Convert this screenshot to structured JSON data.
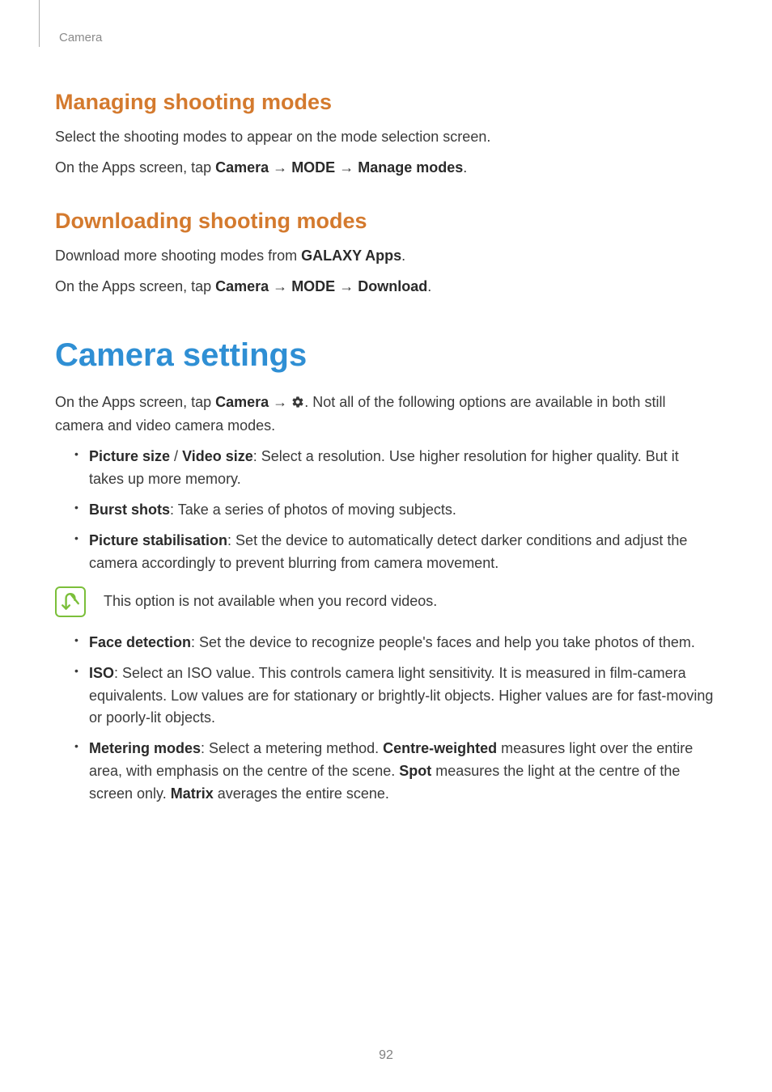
{
  "breadcrumb": "Camera",
  "section1": {
    "heading": "Managing shooting modes",
    "p1": "Select the shooting modes to appear on the mode selection screen.",
    "p2_prefix": "On the Apps screen, tap ",
    "p2_b1": "Camera",
    "p2_arrow1": " → ",
    "p2_b2": "MODE",
    "p2_arrow2": " → ",
    "p2_b3": "Manage modes",
    "p2_suffix": "."
  },
  "section2": {
    "heading": "Downloading shooting modes",
    "p1_prefix": "Download more shooting modes from ",
    "p1_b1": "GALAXY Apps",
    "p1_suffix": ".",
    "p2_prefix": "On the Apps screen, tap ",
    "p2_b1": "Camera",
    "p2_arrow1": " → ",
    "p2_b2": "MODE",
    "p2_arrow2": " → ",
    "p2_b3": "Download",
    "p2_suffix": "."
  },
  "section3": {
    "heading": "Camera settings",
    "intro_prefix": "On the Apps screen, tap ",
    "intro_b1": "Camera",
    "intro_arrow": " → ",
    "intro_suffix": ". Not all of the following options are available in both still camera and video camera modes.",
    "bullets1": {
      "b1_bold1": "Picture size",
      "b1_sep": " / ",
      "b1_bold2": "Video size",
      "b1_rest": ": Select a resolution. Use higher resolution for higher quality. But it takes up more memory.",
      "b2_bold": "Burst shots",
      "b2_rest": ": Take a series of photos of moving subjects.",
      "b3_bold": "Picture stabilisation",
      "b3_rest": ": Set the device to automatically detect darker conditions and adjust the camera accordingly to prevent blurring from camera movement."
    },
    "note": "This option is not available when you record videos.",
    "bullets2": {
      "b4_bold": "Face detection",
      "b4_rest": ": Set the device to recognize people's faces and help you take photos of them.",
      "b5_bold": "ISO",
      "b5_rest": ": Select an ISO value. This controls camera light sensitivity. It is measured in film-camera equivalents. Low values are for stationary or brightly-lit objects. Higher values are for fast-moving or poorly-lit objects.",
      "b6_bold": "Metering modes",
      "b6_p1": ": Select a metering method. ",
      "b6_bold2": "Centre-weighted",
      "b6_p2": " measures light over the entire area, with emphasis on the centre of the scene. ",
      "b6_bold3": "Spot",
      "b6_p3": " measures the light at the centre of the screen only. ",
      "b6_bold4": "Matrix",
      "b6_p4": " averages the entire scene."
    }
  },
  "page_number": "92"
}
